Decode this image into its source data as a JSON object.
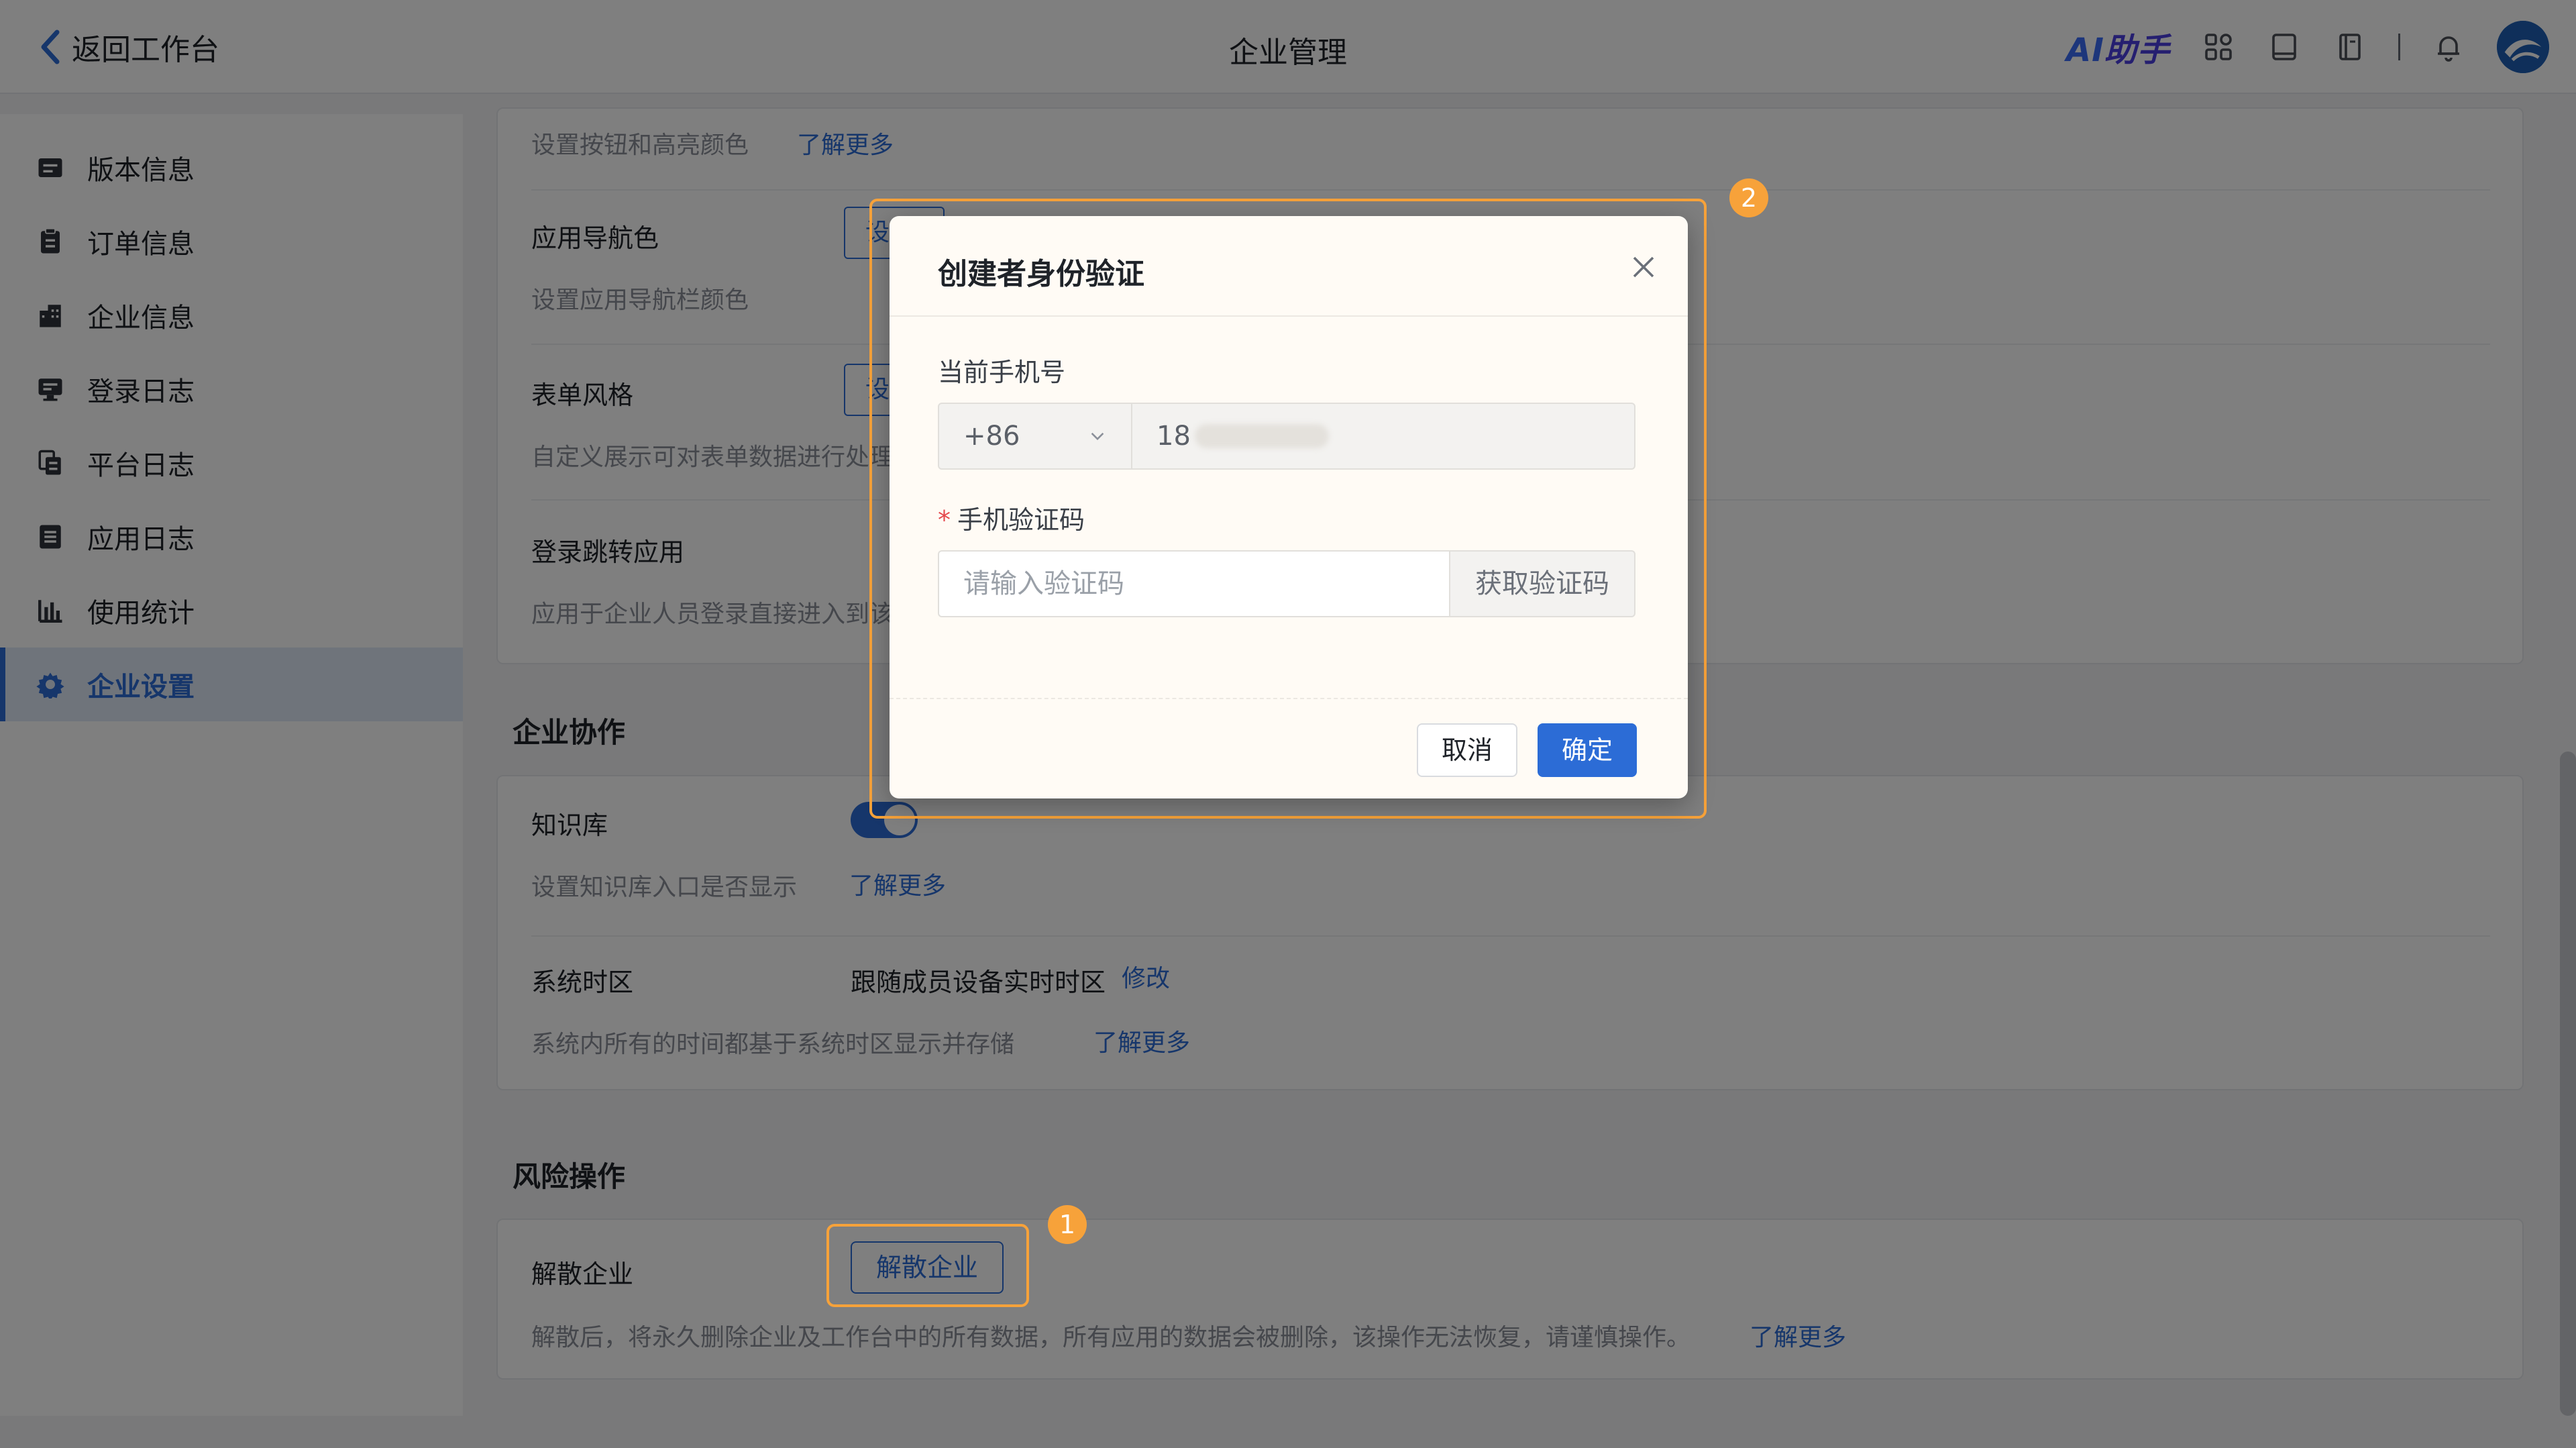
{
  "header": {
    "back_label": "返回工作台",
    "title": "企业管理",
    "ai_prefix": "AI",
    "ai_suffix": "助手",
    "icons": [
      "apps-icon",
      "book-icon",
      "notebook-icon",
      "bell-icon",
      "avatar"
    ]
  },
  "sidebar": {
    "items": [
      {
        "label": "版本信息",
        "icon": "version-icon"
      },
      {
        "label": "订单信息",
        "icon": "order-icon"
      },
      {
        "label": "企业信息",
        "icon": "building-icon"
      },
      {
        "label": "登录日志",
        "icon": "monitor-icon"
      },
      {
        "label": "平台日志",
        "icon": "file-copy-icon"
      },
      {
        "label": "应用日志",
        "icon": "list-icon"
      },
      {
        "label": "使用统计",
        "icon": "bar-chart-icon"
      },
      {
        "label": "企业设置",
        "icon": "gear-icon",
        "active": true
      }
    ]
  },
  "settings": {
    "button_color_desc": "设置按钮和高亮颜色",
    "learn_more": "了解更多",
    "nav_color_label": "应用导航色",
    "nav_color_btn": "设",
    "nav_color_desc": "设置应用导航栏颜色",
    "form_style_label": "表单风格",
    "form_style_btn": "设",
    "form_style_desc": "自定义展示可对表单数据进行处理",
    "login_redirect_label": "登录跳转应用",
    "login_redirect_desc": "应用于企业人员登录直接进入到该"
  },
  "collaboration": {
    "title": "企业协作",
    "kb_label": "知识库",
    "kb_desc": "设置知识库入口是否显示",
    "kb_enabled": true,
    "learn_more": "了解更多",
    "tz_label": "系统时区",
    "tz_value": "跟随成员设备实时时区",
    "tz_edit": "修改",
    "tz_desc": "系统内所有的时间都基于系统时区显示并存储",
    "tz_learn_more": "了解更多"
  },
  "risk": {
    "title": "风险操作",
    "dissolve_label": "解散企业",
    "dissolve_button": "解散企业",
    "dissolve_desc": "解散后，将永久删除企业及工作台中的所有数据，所有应用的数据会被删除，该操作无法恢复，请谨慎操作。",
    "learn_more": "了解更多"
  },
  "badges": {
    "one": "1",
    "two": "2"
  },
  "dialog": {
    "title": "创建者身份验证",
    "phone_label": "当前手机号",
    "country_code": "+86",
    "phone_visible": "18",
    "code_label": "手机验证码",
    "required_mark": "*",
    "code_placeholder": "请输入验证码",
    "get_code": "获取验证码",
    "cancel": "取消",
    "confirm": "确定"
  },
  "colors": {
    "accent": "#2c6cd6",
    "highlight": "#f7a23a"
  }
}
